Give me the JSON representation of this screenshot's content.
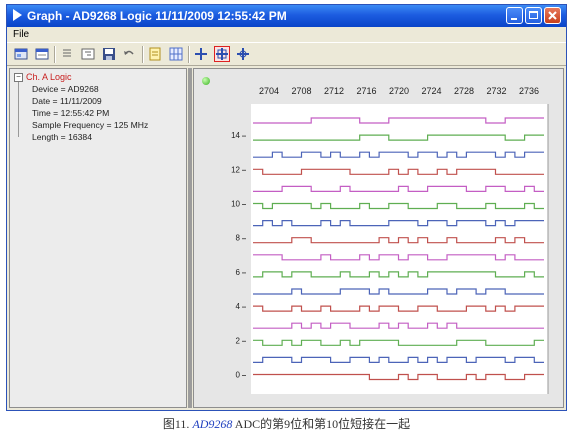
{
  "window": {
    "title": "Graph - AD9268 Logic 11/11/2009 12:55:42 PM"
  },
  "menu": {
    "items": [
      "File"
    ]
  },
  "toolbar": {
    "buttons": [
      "open-icon",
      "display-icon",
      "list-icon",
      "list-tree-icon",
      "save-icon",
      "undo-icon",
      "note-icon",
      "grid-icon",
      "cursor-icon",
      "cursor-selected-icon",
      "cursor-move-icon"
    ]
  },
  "tree": {
    "root": "Ch. A Logic",
    "items": [
      "Device = AD9268",
      "Date = 11/11/2009",
      "Time = 12:55:42 PM",
      "Sample Frequency = 125 MHz",
      "Length = 16384"
    ]
  },
  "chart_data": {
    "type": "line",
    "x_ticks": [
      2704,
      2708,
      2712,
      2716,
      2720,
      2724,
      2728,
      2732,
      2736
    ],
    "y_ticks": [
      14,
      12,
      10,
      8,
      6,
      4,
      2,
      0
    ],
    "grid": false
  },
  "caption": {
    "prefix": "图11. ",
    "link": "AD9268",
    "suffix": " ADC的第9位和第10位短接在一起"
  },
  "colors": {
    "plot_bg": "#ffffff",
    "bit_colors": [
      "#c0504d",
      "#4c64b8",
      "#5fae52",
      "#c45ec4",
      "#c0504d",
      "#4c64b8",
      "#5fae52",
      "#c45ec4",
      "#c0504d",
      "#4c64b8",
      "#5fae52",
      "#c45ec4",
      "#c0504d",
      "#4c64b8",
      "#5fae52",
      "#c45ec4"
    ]
  }
}
